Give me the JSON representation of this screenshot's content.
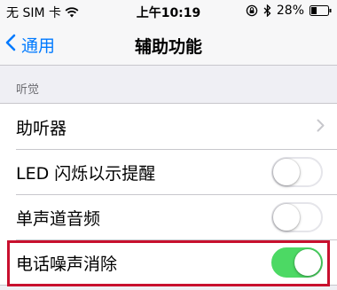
{
  "status_bar": {
    "carrier": "无 SIM 卡",
    "time": "上午10:19",
    "battery": "28%"
  },
  "nav": {
    "back_label": "通用",
    "title": "辅助功能"
  },
  "section": {
    "header": "听觉"
  },
  "rows": [
    {
      "label": "助听器",
      "control": "chevron"
    },
    {
      "label": "LED 闪烁以示提醒",
      "control": "toggle",
      "on": false
    },
    {
      "label": "单声道音频",
      "control": "toggle",
      "on": false
    },
    {
      "label": "电话噪声消除",
      "control": "toggle",
      "on": true
    }
  ],
  "colors": {
    "accent": "#007aff",
    "toggle_on": "#4cd964",
    "highlight": "#c8102e"
  },
  "icons": [
    "wifi-icon",
    "lock-rotation-icon",
    "bluetooth-icon",
    "battery-icon",
    "back-chevron-icon",
    "chevron-right-icon"
  ]
}
